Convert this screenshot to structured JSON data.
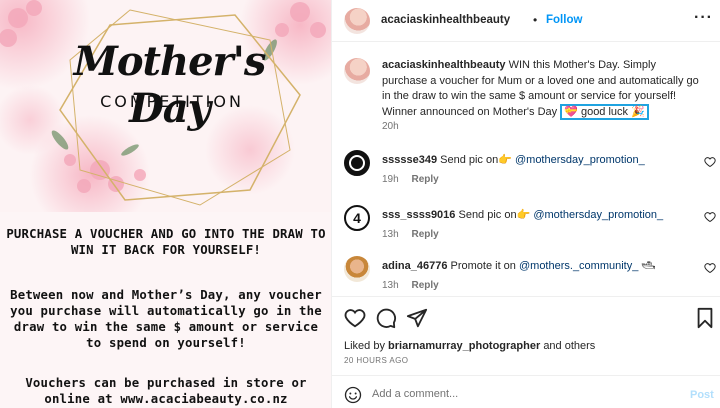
{
  "image": {
    "title": "Mother's Day",
    "subtitle": "COMPETITION",
    "para1": "PURCHASE A VOUCHER AND GO INTO THE DRAW TO WIN IT BACK FOR YOURSELF!",
    "para2": "Between now and Mother’s Day, any voucher you purchase will automatically go in the draw to win the same $ amount or service to spend on yourself!",
    "para3": "Vouchers can be purchased in store or online at www.acaciabeauty.co.nz"
  },
  "header": {
    "username": "acaciaskinhealthbeauty",
    "dot": "•",
    "follow_label": "Follow",
    "more_label": "···"
  },
  "caption": {
    "username": "acaciaskinhealthbeauty",
    "text": "WIN this Mother's Day. Simply purchase a voucher for Mum or a loved one and automatically go in the draw to win the same $ amount or service for yourself! Winner announced on Mother's Day",
    "highlight": "💝 good luck 🎉",
    "time": "20h"
  },
  "comments": [
    {
      "username": "ssssse349",
      "text": "Send pic on👉",
      "mention": "@mothersday_promotion_",
      "time": "19h",
      "reply": "Reply"
    },
    {
      "username": "sss_ssss9016",
      "text": "Send pic on👉",
      "mention": "@mothersday_promotion_",
      "time": "13h",
      "reply": "Reply"
    },
    {
      "username": "adina_46776",
      "text": "Promote it on",
      "mention": "@mothers._community_",
      "trail": "🛥",
      "time": "13h",
      "reply": "Reply"
    }
  ],
  "likes": {
    "prefix": "Liked by",
    "user": "briarnamurray_photographer",
    "suffix": "and others"
  },
  "posted_ago": "20 HOURS AGO",
  "add_comment": {
    "placeholder": "Add a comment...",
    "post_label": "Post"
  },
  "colors": {
    "accent": "#0095f6",
    "highlight_border": "#1fa3e0",
    "secondary_text": "#737373"
  }
}
